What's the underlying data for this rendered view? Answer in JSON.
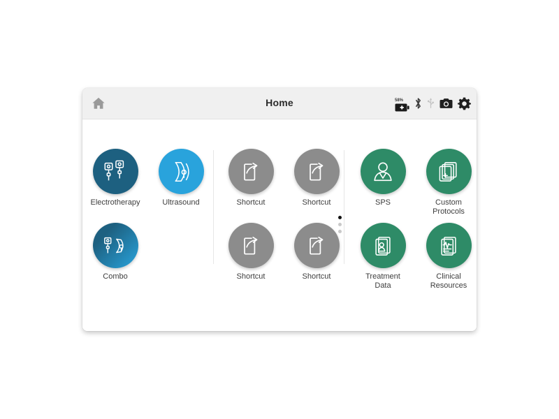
{
  "window": {
    "title": "Home"
  },
  "topbar": {
    "home_icon": "home-icon",
    "title": "Home",
    "status": {
      "battery_percent": "58%",
      "battery_icon": "battery-icon",
      "bluetooth_icon": "bluetooth-icon",
      "usb_icon": "usb-icon",
      "camera_icon": "camera-icon",
      "settings_icon": "gear-icon"
    }
  },
  "tiles": [
    {
      "id": "electrotherapy",
      "label": "Electrotherapy",
      "icon": "electrode-pads-icon",
      "color": "#1d6080",
      "group": "modalities"
    },
    {
      "id": "ultrasound",
      "label": "Ultrasound",
      "icon": "ultrasound-wave-icon",
      "color": "#29a3dc",
      "group": "modalities"
    },
    {
      "id": "combo",
      "label": "Combo",
      "icon": "combo-icon",
      "color": "#1d6080",
      "group": "modalities"
    },
    {
      "id": "shortcut-1",
      "label": "Shortcut",
      "icon": "shortcut-arrow-icon",
      "color": "#8c8c8c",
      "group": "shortcuts"
    },
    {
      "id": "shortcut-2",
      "label": "Shortcut",
      "icon": "shortcut-arrow-icon",
      "color": "#8c8c8c",
      "group": "shortcuts"
    },
    {
      "id": "shortcut-3",
      "label": "Shortcut",
      "icon": "shortcut-arrow-icon",
      "color": "#8c8c8c",
      "group": "shortcuts"
    },
    {
      "id": "shortcut-4",
      "label": "Shortcut",
      "icon": "shortcut-arrow-icon",
      "color": "#8c8c8c",
      "group": "shortcuts"
    },
    {
      "id": "sps",
      "label": "SPS",
      "icon": "person-icon",
      "color": "#2e8b67",
      "group": "library"
    },
    {
      "id": "custom-protocols",
      "label": "Custom\nProtocols",
      "icon": "documents-plus-icon",
      "color": "#2e8b67",
      "group": "library"
    },
    {
      "id": "treatment-data",
      "label": "Treatment\nData",
      "icon": "patient-record-icon",
      "color": "#2e8b67",
      "group": "library"
    },
    {
      "id": "clinical-resources",
      "label": "Clinical\nResources",
      "icon": "ecg-document-icon",
      "color": "#2e8b67",
      "group": "library"
    }
  ],
  "pagination": {
    "total": 3,
    "active_index": 0
  },
  "colors": {
    "electro": "#1d6080",
    "ultrasound": "#29a3dc",
    "shortcut_gray": "#8c8c8c",
    "green": "#2e8b67",
    "topbar_bg": "#f0f0f0",
    "label_text": "#3d3d3d"
  }
}
